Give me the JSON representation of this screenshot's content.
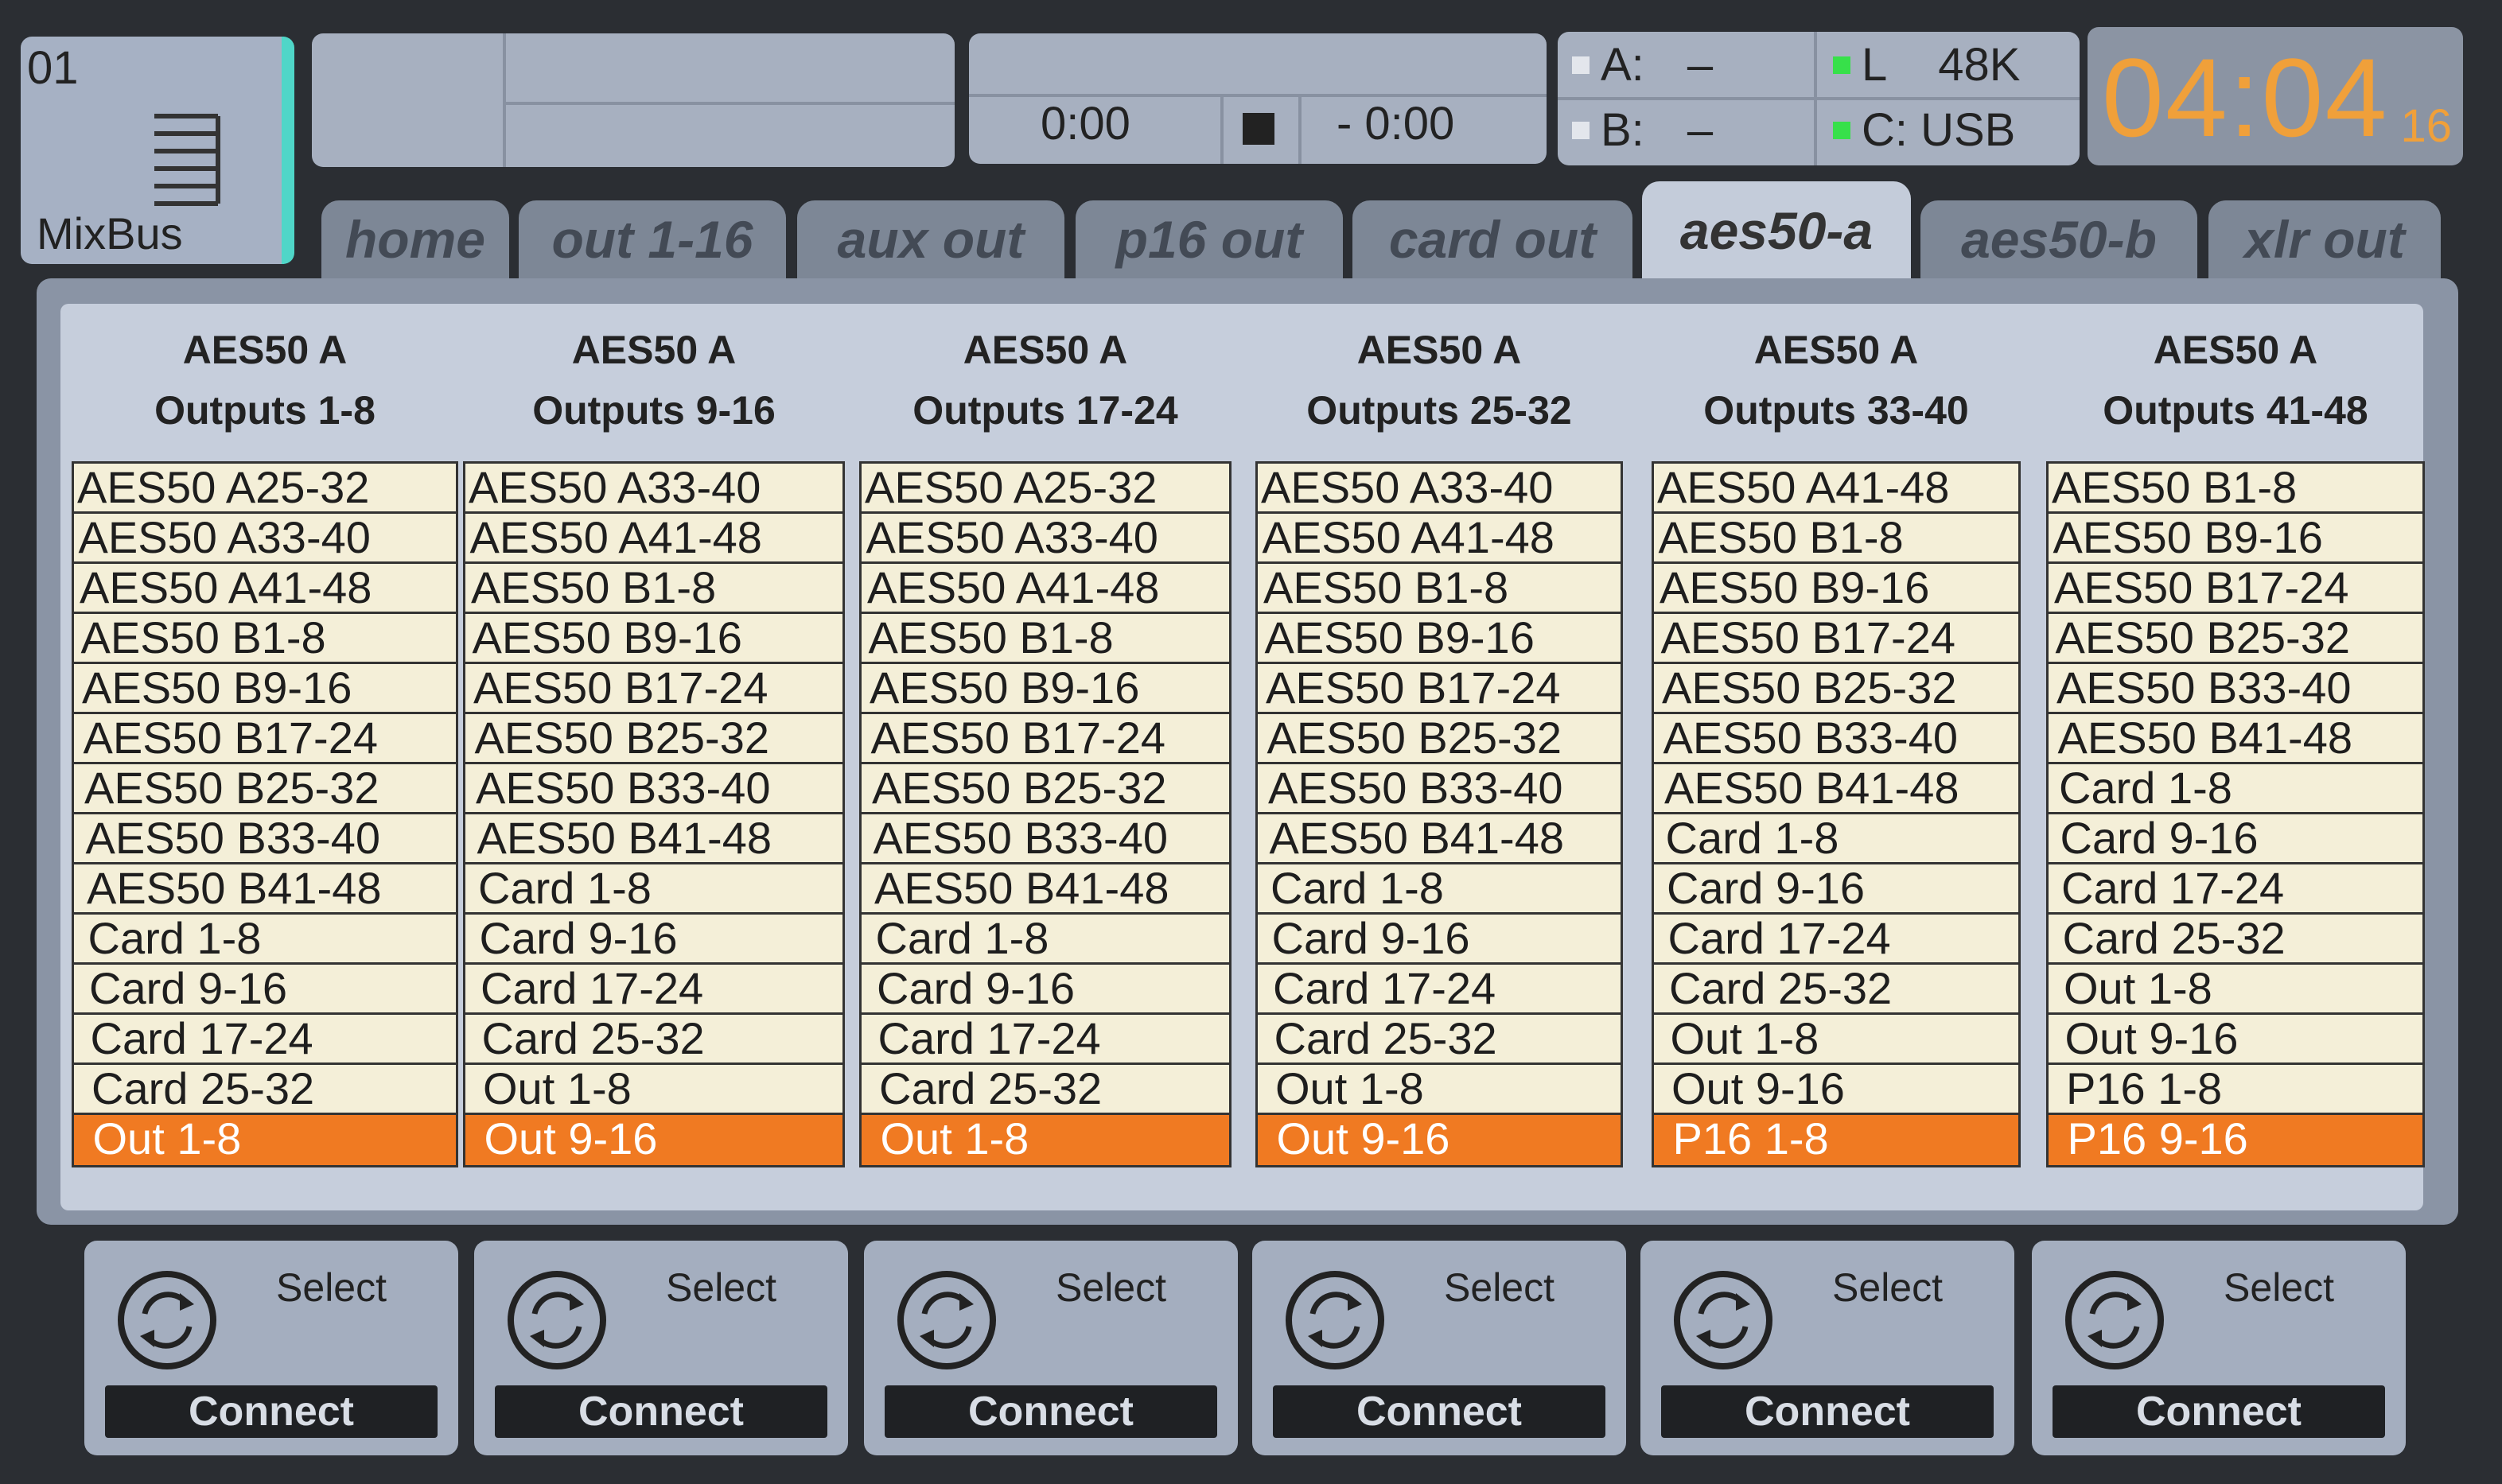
{
  "channel": {
    "number": "01",
    "name": "MixBus"
  },
  "transport": {
    "elapsed": "0:00",
    "remaining": "- 0:00"
  },
  "status": {
    "a_label": "A:",
    "a_value": "–",
    "b_label": "B:",
    "b_value": "–",
    "l_label": "L",
    "l_value": "48K",
    "c_label": "C: USB"
  },
  "clock": {
    "time": "04:04",
    "seconds": "16",
    "color": "#f0a03a"
  },
  "tabs": [
    {
      "label": "home"
    },
    {
      "label": "out 1-16"
    },
    {
      "label": "aux out"
    },
    {
      "label": "p16 out"
    },
    {
      "label": "card out"
    },
    {
      "label": "aes50-a",
      "active": true
    },
    {
      "label": "aes50-b"
    },
    {
      "label": "xlr out"
    }
  ],
  "accent_color": "#f07a22",
  "columns": [
    {
      "title": "AES50 A",
      "subtitle": "Outputs 1-8",
      "items": [
        "AES50 A25-32",
        "AES50 A33-40",
        "AES50 A41-48",
        "AES50 B1-8",
        "AES50 B9-16",
        "AES50 B17-24",
        "AES50 B25-32",
        "AES50 B33-40",
        "AES50 B41-48",
        "Card 1-8",
        "Card 9-16",
        "Card 17-24",
        "Card 25-32",
        "Out 1-8"
      ],
      "selected": "Out 1-8"
    },
    {
      "title": "AES50 A",
      "subtitle": "Outputs 9-16",
      "items": [
        "AES50 A33-40",
        "AES50 A41-48",
        "AES50 B1-8",
        "AES50 B9-16",
        "AES50 B17-24",
        "AES50 B25-32",
        "AES50 B33-40",
        "AES50 B41-48",
        "Card 1-8",
        "Card 9-16",
        "Card 17-24",
        "Card 25-32",
        "Out 1-8",
        "Out 9-16"
      ],
      "selected": "Out 9-16"
    },
    {
      "title": "AES50 A",
      "subtitle": "Outputs 17-24",
      "items": [
        "AES50 A25-32",
        "AES50 A33-40",
        "AES50 A41-48",
        "AES50 B1-8",
        "AES50 B9-16",
        "AES50 B17-24",
        "AES50 B25-32",
        "AES50 B33-40",
        "AES50 B41-48",
        "Card 1-8",
        "Card 9-16",
        "Card 17-24",
        "Card 25-32",
        "Out 1-8"
      ],
      "selected": "Out 1-8"
    },
    {
      "title": "AES50 A",
      "subtitle": "Outputs 25-32",
      "items": [
        "AES50 A33-40",
        "AES50 A41-48",
        "AES50 B1-8",
        "AES50 B9-16",
        "AES50 B17-24",
        "AES50 B25-32",
        "AES50 B33-40",
        "AES50 B41-48",
        "Card 1-8",
        "Card 9-16",
        "Card 17-24",
        "Card 25-32",
        "Out 1-8",
        "Out 9-16"
      ],
      "selected": "Out 9-16"
    },
    {
      "title": "AES50 A",
      "subtitle": "Outputs 33-40",
      "items": [
        "AES50 A41-48",
        "AES50 B1-8",
        "AES50 B9-16",
        "AES50 B17-24",
        "AES50 B25-32",
        "AES50 B33-40",
        "AES50 B41-48",
        "Card 1-8",
        "Card 9-16",
        "Card 17-24",
        "Card 25-32",
        "Out 1-8",
        "Out 9-16",
        "P16 1-8"
      ],
      "selected": "P16 1-8"
    },
    {
      "title": "AES50 A",
      "subtitle": "Outputs 41-48",
      "items": [
        "AES50 B1-8",
        "AES50 B9-16",
        "AES50 B17-24",
        "AES50 B25-32",
        "AES50 B33-40",
        "AES50 B41-48",
        "Card 1-8",
        "Card 9-16",
        "Card 17-24",
        "Card 25-32",
        "Out 1-8",
        "Out 9-16",
        "P16 1-8",
        "P16 9-16"
      ],
      "selected": "P16 9-16"
    }
  ],
  "buttons": [
    {
      "select_label": "Select",
      "connect_label": "Connect"
    },
    {
      "select_label": "Select",
      "connect_label": "Connect"
    },
    {
      "select_label": "Select",
      "connect_label": "Connect"
    },
    {
      "select_label": "Select",
      "connect_label": "Connect"
    },
    {
      "select_label": "Select",
      "connect_label": "Connect"
    },
    {
      "select_label": "Select",
      "connect_label": "Connect"
    }
  ]
}
